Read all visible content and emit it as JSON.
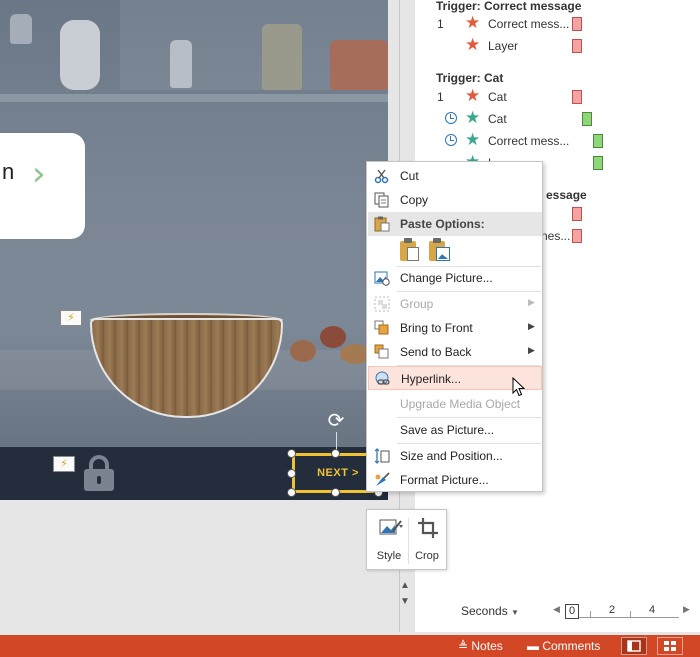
{
  "slide": {
    "speech_text": "n",
    "chevron_glyph": "›",
    "next_button_label": "NEXT  >",
    "trigger_glyph": "⚡",
    "rotate_glyph": "⟳"
  },
  "context_menu": {
    "cut": "Cut",
    "copy": "Copy",
    "paste_options": "Paste Options:",
    "change_picture": "Change Picture...",
    "group": "Group",
    "bring_to_front": "Bring to Front",
    "send_to_back": "Send to Back",
    "hyperlink": "Hyperlink...",
    "upgrade_media": "Upgrade Media Object",
    "save_as_picture": "Save as Picture...",
    "size_and_position": "Size and Position...",
    "format_picture": "Format Picture...",
    "submenu_arrow": "▶"
  },
  "mini_toolbar": {
    "style": "Style",
    "crop": "Crop"
  },
  "animation_pane": {
    "groups": [
      {
        "title": "Trigger: Correct message",
        "rows": [
          {
            "num": "1",
            "star": "red",
            "name": "Correct mess...",
            "bar": "red"
          },
          {
            "num": "",
            "star": "red",
            "name": "Layer",
            "bar": "red"
          }
        ]
      },
      {
        "title": "Trigger: Cat",
        "rows": [
          {
            "num": "1",
            "star": "red",
            "name": "Cat",
            "bar": "red"
          },
          {
            "num": "",
            "clock": true,
            "star": "teal",
            "name": "Cat",
            "bar": "green"
          },
          {
            "num": "",
            "clock": true,
            "star": "teal",
            "name": "Correct mess...",
            "bar": "green"
          },
          {
            "num": "",
            "star": "teal",
            "name": "L",
            "bar": "green"
          }
        ]
      },
      {
        "title": "essage",
        "rows": [
          {
            "num": "",
            "star": "red",
            "name": "",
            "bar": "red"
          },
          {
            "num": "",
            "star": "red",
            "name": "nes...",
            "bar": "red"
          }
        ]
      }
    ],
    "seconds_label": "Seconds",
    "seconds_caret": "▼",
    "timeline_ticks": [
      "0",
      "2",
      "4"
    ],
    "scroll_up": "▲",
    "scroll_down": "▼",
    "left_arrow": "◀",
    "right_arrow": "▶"
  },
  "status_bar": {
    "notes": "Notes",
    "comments": "Comments",
    "accent_color": "#d24726"
  }
}
